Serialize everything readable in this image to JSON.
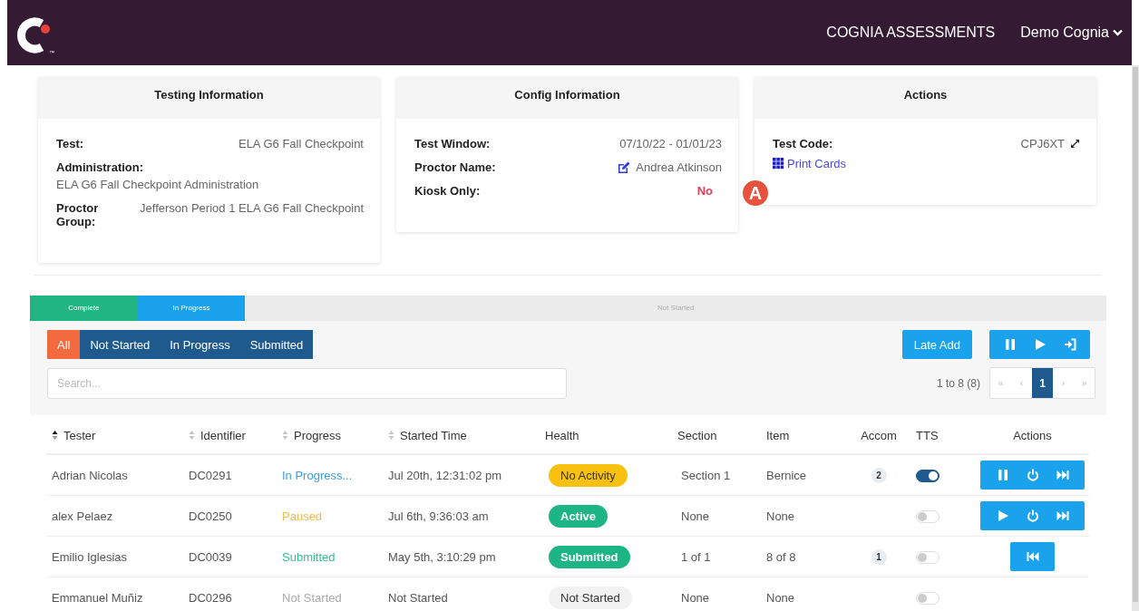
{
  "header": {
    "logo_mark": "™",
    "nav_link": "COGNIA ASSESSMENTS",
    "user_menu": "Demo Cognia"
  },
  "cards": [
    {
      "title": "Testing Information",
      "fields": [
        {
          "label": "Test:",
          "value": "ELA G6 Fall Checkpoint",
          "kind": "inline"
        },
        {
          "label": "Administration:",
          "value": "ELA G6 Fall Checkpoint Administration",
          "kind": "stacked"
        },
        {
          "label": "Proctor Group:",
          "value": "Jefferson Period 1 ELA G6 Fall Checkpoint",
          "kind": "inline"
        }
      ]
    },
    {
      "title": "Config Information",
      "fields": [
        {
          "label": "Test Window:",
          "value": "07/10/22 - 01/01/23",
          "kind": "inline"
        },
        {
          "label": "Proctor Name:",
          "value": "Andrea Atkinson",
          "kind": "editable"
        },
        {
          "label": "Kiosk Only:",
          "value": "No",
          "kind": "flag"
        }
      ]
    },
    {
      "title": "Actions",
      "fields": [
        {
          "label": "Test Code:",
          "value": "CPJ6XT",
          "kind": "code"
        }
      ],
      "links": [
        "Print Cards"
      ]
    }
  ],
  "callout": {
    "label": "A"
  },
  "progress_bar": [
    {
      "label": "Complete",
      "kind": "complete",
      "level": 0.1
    },
    {
      "label": "In Progress",
      "kind": "in_progress",
      "level": 0.1
    },
    {
      "label": "Not Started",
      "kind": "not_started",
      "level": 0.8
    }
  ],
  "filters": [
    {
      "label": "All",
      "selected": true
    },
    {
      "label": "Not Started",
      "selected": false
    },
    {
      "label": "In Progress",
      "selected": false
    },
    {
      "label": "Submitted",
      "selected": false
    }
  ],
  "late_add": "Late Add",
  "bulk_actions": [
    {
      "kind": "pause"
    },
    {
      "kind": "play"
    },
    {
      "kind": "enter"
    }
  ],
  "search": {
    "placeholder": "Search..."
  },
  "pagination": {
    "summary": "1 to 8 (8)",
    "pages": [
      {
        "label": "«",
        "selected": false
      },
      {
        "label": "‹",
        "selected": false
      },
      {
        "label": "1",
        "selected": true
      },
      {
        "label": "›",
        "selected": false
      },
      {
        "label": "»",
        "selected": false
      }
    ]
  },
  "table": {
    "columns": [
      {
        "label": "Tester",
        "sorted": true
      },
      {
        "label": "Identifier",
        "sorted": false
      },
      {
        "label": "Progress",
        "sorted": false
      },
      {
        "label": "Started Time",
        "sorted": false
      },
      {
        "label": "Health"
      },
      {
        "label": "Section"
      },
      {
        "label": "Item"
      },
      {
        "label": "Accom"
      },
      {
        "label": "TTS"
      },
      {
        "label": "Actions"
      }
    ],
    "rows": [
      {
        "tester": "Adrian Nicolas",
        "identifier": "DC0291",
        "progress": {
          "label": "In Progress...",
          "kind": "in_progress"
        },
        "started": "Jul 20th, 12:31:02 pm",
        "health": {
          "label": "No Activity",
          "kind": "warning"
        },
        "section": "Section 1",
        "item": "Bernice",
        "accom": "2",
        "tts": {
          "on": true
        },
        "actions": [
          {
            "kind": "pause"
          },
          {
            "kind": "power"
          },
          {
            "kind": "forward"
          }
        ]
      },
      {
        "tester": "alex Pelaez",
        "identifier": "DC0250",
        "progress": {
          "label": "Paused",
          "kind": "paused"
        },
        "started": "Jul 6th, 9:36:03 am",
        "health": {
          "label": "Active",
          "kind": "active"
        },
        "section": "None",
        "item": "None",
        "tts": {
          "on": false
        },
        "actions": [
          {
            "kind": "play"
          },
          {
            "kind": "power"
          },
          {
            "kind": "forward"
          }
        ]
      },
      {
        "tester": "Emilio Iglesias",
        "identifier": "DC0039",
        "progress": {
          "label": "Submitted",
          "kind": "submitted"
        },
        "started": "May 5th, 3:10:29 pm",
        "health": {
          "label": "Submitted",
          "kind": "active"
        },
        "section": "1 of 1",
        "item": "8 of 8",
        "accom": "1",
        "tts": {
          "on": false
        },
        "actions": [
          {
            "kind": "back"
          }
        ]
      },
      {
        "tester": "Emmanuel Muñiz",
        "identifier": "DC0296",
        "progress": {
          "label": "Not Started",
          "kind": "not_started"
        },
        "started": "Not Started",
        "health": {
          "label": "Not Started",
          "kind": "idle"
        },
        "section": "None",
        "item": "None",
        "tts": {
          "on": false
        }
      }
    ]
  }
}
